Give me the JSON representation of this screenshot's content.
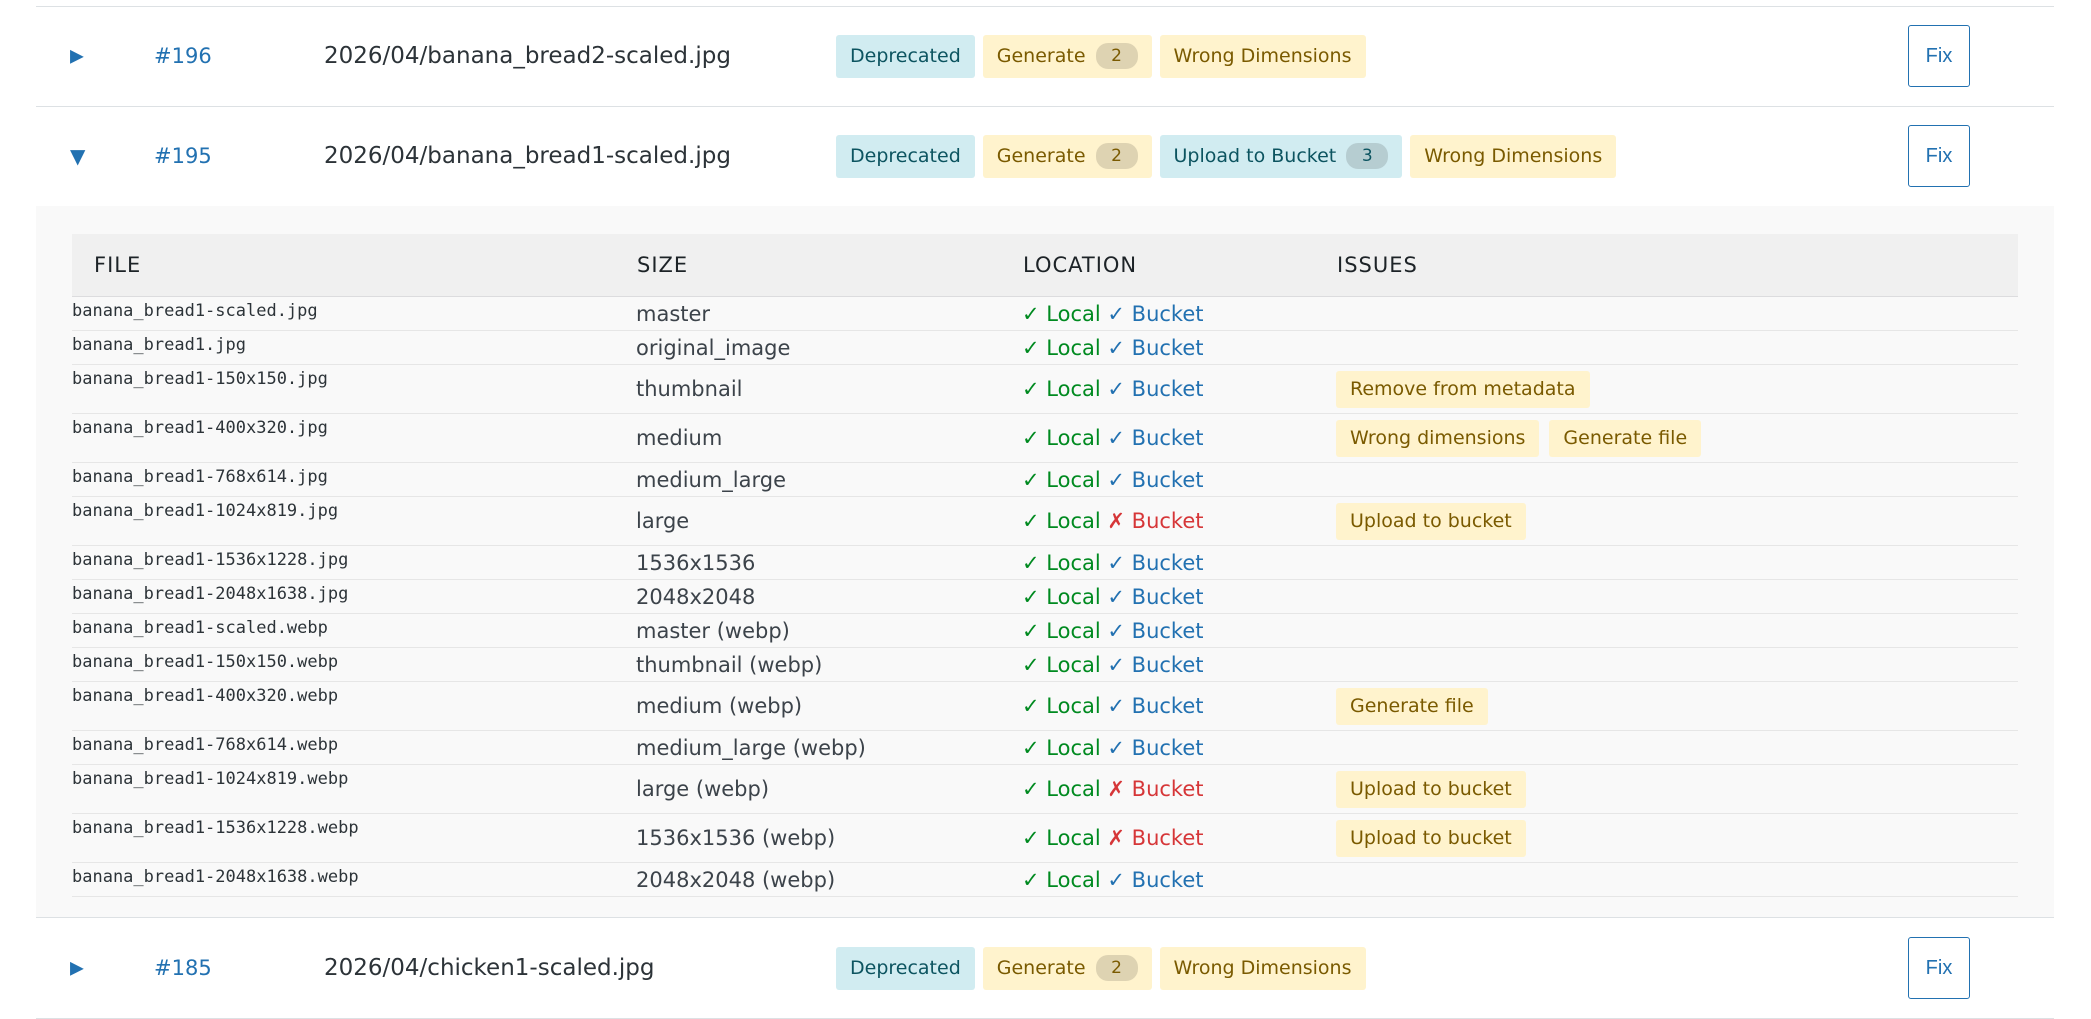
{
  "rows_top": [
    {
      "toggle": "▶",
      "id": "#196",
      "path": "2026/04/banana_bread2-scaled.jpg",
      "badges": [
        {
          "label": "Deprecated",
          "type": "info"
        },
        {
          "label": "Generate",
          "type": "warn",
          "count": "2"
        },
        {
          "label": "Wrong Dimensions",
          "type": "warn"
        }
      ],
      "fix": "Fix"
    },
    {
      "toggle": "▼",
      "id": "#195",
      "path": "2026/04/banana_bread1-scaled.jpg",
      "badges": [
        {
          "label": "Deprecated",
          "type": "info"
        },
        {
          "label": "Generate",
          "type": "warn",
          "count": "2"
        },
        {
          "label": "Upload to Bucket",
          "type": "info",
          "count": "3"
        },
        {
          "label": "Wrong Dimensions",
          "type": "warn"
        }
      ],
      "fix": "Fix"
    }
  ],
  "table": {
    "headers": [
      "FILE",
      "SIZE",
      "LOCATION",
      "ISSUES"
    ],
    "local_label": "✓ Local",
    "bucket_ok_label": "✓ Bucket",
    "bucket_missing_label": "✗ Bucket",
    "rows": [
      {
        "file": "banana_bread1-scaled.jpg",
        "size": "master",
        "bucket": true,
        "issues": []
      },
      {
        "file": "banana_bread1.jpg",
        "size": "original_image",
        "bucket": true,
        "issues": []
      },
      {
        "file": "banana_bread1-150x150.jpg",
        "size": "thumbnail",
        "bucket": true,
        "issues": [
          "Remove from metadata"
        ]
      },
      {
        "file": "banana_bread1-400x320.jpg",
        "size": "medium",
        "bucket": true,
        "issues": [
          "Wrong dimensions",
          "Generate file"
        ]
      },
      {
        "file": "banana_bread1-768x614.jpg",
        "size": "medium_large",
        "bucket": true,
        "issues": []
      },
      {
        "file": "banana_bread1-1024x819.jpg",
        "size": "large",
        "bucket": false,
        "issues": [
          "Upload to bucket"
        ]
      },
      {
        "file": "banana_bread1-1536x1228.jpg",
        "size": "1536x1536",
        "bucket": true,
        "issues": []
      },
      {
        "file": "banana_bread1-2048x1638.jpg",
        "size": "2048x2048",
        "bucket": true,
        "issues": []
      },
      {
        "file": "banana_bread1-scaled.webp",
        "size": "master (webp)",
        "bucket": true,
        "issues": []
      },
      {
        "file": "banana_bread1-150x150.webp",
        "size": "thumbnail (webp)",
        "bucket": true,
        "issues": []
      },
      {
        "file": "banana_bread1-400x320.webp",
        "size": "medium (webp)",
        "bucket": true,
        "issues": [
          "Generate file"
        ]
      },
      {
        "file": "banana_bread1-768x614.webp",
        "size": "medium_large (webp)",
        "bucket": true,
        "issues": []
      },
      {
        "file": "banana_bread1-1024x819.webp",
        "size": "large (webp)",
        "bucket": false,
        "issues": [
          "Upload to bucket"
        ]
      },
      {
        "file": "banana_bread1-1536x1228.webp",
        "size": "1536x1536 (webp)",
        "bucket": false,
        "issues": [
          "Upload to bucket"
        ]
      },
      {
        "file": "banana_bread1-2048x1638.webp",
        "size": "2048x2048 (webp)",
        "bucket": true,
        "issues": []
      }
    ]
  },
  "row_bottom": {
    "toggle": "▶",
    "id": "#185",
    "path": "2026/04/chicken1-scaled.jpg",
    "badges": [
      {
        "label": "Deprecated",
        "type": "info"
      },
      {
        "label": "Generate",
        "type": "warn",
        "count": "2"
      },
      {
        "label": "Wrong Dimensions",
        "type": "warn"
      }
    ],
    "fix": "Fix"
  },
  "colors": {
    "link": "#2271b1",
    "ok": "#008a20",
    "bad": "#d63638",
    "info_bg": "#d1ecf1",
    "warn_bg": "#fff3cd"
  }
}
